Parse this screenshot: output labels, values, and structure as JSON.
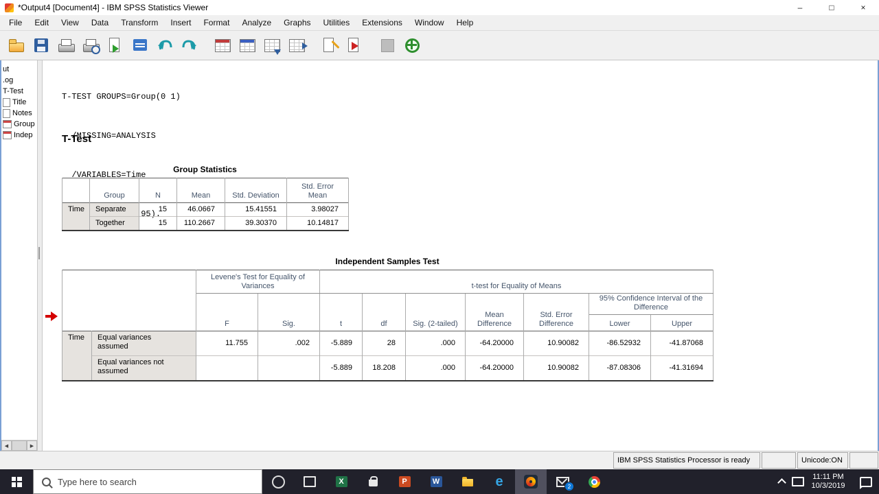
{
  "window": {
    "title": "*Output4 [Document4] - IBM SPSS Statistics Viewer",
    "controls": {
      "minimize": "–",
      "maximize": "□",
      "close": "×"
    }
  },
  "menu": {
    "items": [
      "File",
      "Edit",
      "View",
      "Data",
      "Transform",
      "Insert",
      "Format",
      "Analyze",
      "Graphs",
      "Utilities",
      "Extensions",
      "Window",
      "Help"
    ]
  },
  "icons": {
    "scroll_left": "◀",
    "scroll_right": "▶"
  },
  "outline": {
    "items": [
      {
        "label": "ut"
      },
      {
        "label": ".og"
      },
      {
        "label": "T-Test"
      },
      {
        "label": "Title"
      },
      {
        "label": "Notes"
      },
      {
        "label": "Group"
      },
      {
        "label": "Indep"
      }
    ]
  },
  "syntax": {
    "lines": [
      "T-TEST GROUPS=Group(0 1)",
      "  /MISSING=ANALYSIS",
      "  /VARIABLES=Time",
      "  /CRITERIA=CI(.95)."
    ]
  },
  "output": {
    "heading": "T-Test",
    "group_stats": {
      "title": "Group Statistics",
      "headers": {
        "group": "Group",
        "n": "N",
        "mean": "Mean",
        "sd": "Std. Deviation",
        "se": "Std. Error Mean"
      },
      "row_label": "Time",
      "rows": [
        {
          "group": "Separate",
          "n": "15",
          "mean": "46.0667",
          "sd": "15.41551",
          "se": "3.98027"
        },
        {
          "group": "Together",
          "n": "15",
          "mean": "110.2667",
          "sd": "39.30370",
          "se": "10.14817"
        }
      ]
    },
    "ind_test": {
      "title": "Independent Samples Test",
      "spanners": {
        "levene": "Levene's Test for Equality of Variances",
        "ttest": "t-test for Equality of Means",
        "ci": "95% Confidence Interval of the Difference"
      },
      "headers": {
        "f": "F",
        "sig": "Sig.",
        "t": "t",
        "df": "df",
        "sig2": "Sig. (2-tailed)",
        "mean_diff": "Mean Difference",
        "se_diff": "Std. Error Difference",
        "lower": "Lower",
        "upper": "Upper"
      },
      "row_label": "Time",
      "rows": [
        {
          "label": "Equal variances assumed",
          "f": "11.755",
          "sig": ".002",
          "t": "-5.889",
          "df": "28",
          "sig2": ".000",
          "mean_diff": "-64.20000",
          "se_diff": "10.90082",
          "lower": "-86.52932",
          "upper": "-41.87068"
        },
        {
          "label": "Equal variances not assumed",
          "f": "",
          "sig": "",
          "t": "-5.889",
          "df": "18.208",
          "sig2": ".000",
          "mean_diff": "-64.20000",
          "se_diff": "10.90082",
          "lower": "-87.08306",
          "upper": "-41.31694"
        }
      ]
    }
  },
  "status": {
    "processor": "IBM SPSS Statistics Processor is ready",
    "unicode": "Unicode:ON"
  },
  "taskbar": {
    "search_placeholder": "Type here to search",
    "mail_badge": "2",
    "clock": {
      "time": "11:11 PM",
      "date": "10/3/2019"
    },
    "letters": {
      "excel": "X",
      "powerpoint": "P",
      "word": "W",
      "edge": "e"
    }
  }
}
